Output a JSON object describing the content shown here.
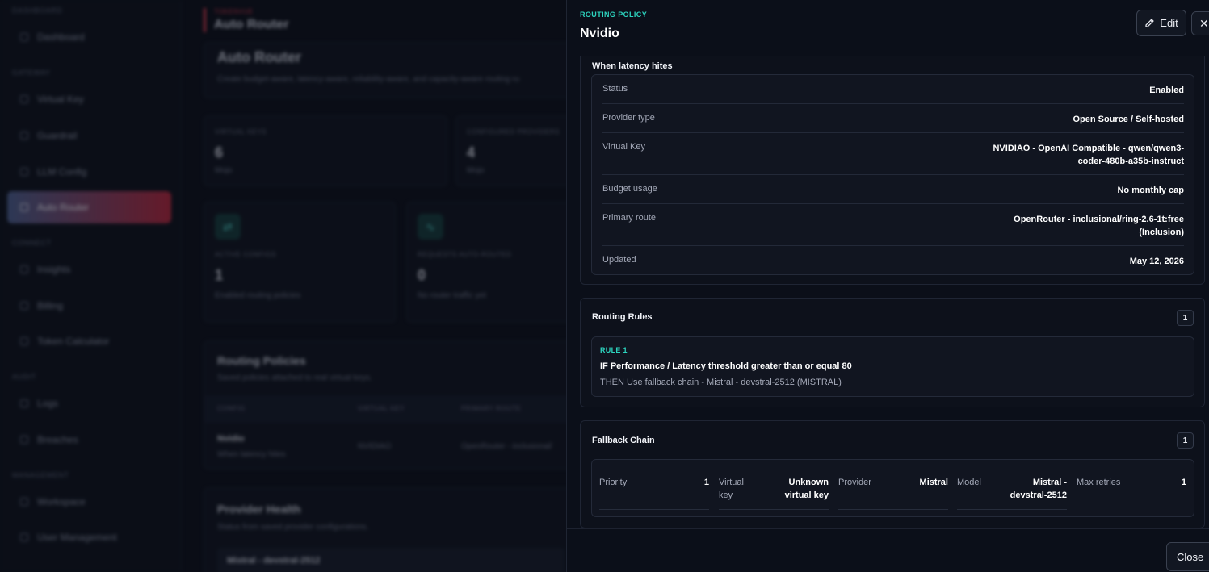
{
  "background": {
    "sidebar": {
      "sections": [
        {
          "label": "DASHBOARD"
        },
        {
          "label": "GATEWAY"
        },
        {
          "label": "CONNECT"
        },
        {
          "label": "AUDIT"
        },
        {
          "label": "MANAGEMENT"
        }
      ],
      "items": [
        {
          "label": "Dashboard"
        },
        {
          "label": "Virtual Key"
        },
        {
          "label": "Guardrail"
        },
        {
          "label": "LLM Config"
        },
        {
          "label": "Auto Router",
          "active": true
        },
        {
          "label": "Insights"
        },
        {
          "label": "Billing"
        },
        {
          "label": "Token Calculator"
        },
        {
          "label": "Logs"
        },
        {
          "label": "Breaches"
        },
        {
          "label": "Workspace"
        },
        {
          "label": "User Management"
        }
      ]
    },
    "header": {
      "eyebrow": "TOKENVUE",
      "title": "Auto Router"
    },
    "intro": {
      "title": "Auto Router",
      "subtitle": "Create budget-aware, latency-aware, reliability-aware, and capacity-aware routing ru"
    },
    "stats": [
      {
        "label": "VIRTUAL KEYS",
        "value": "6",
        "sub": "Mojo"
      },
      {
        "label": "CONFIGURED PROVIDERS",
        "value": "4",
        "sub": "Mojo"
      }
    ],
    "metrics": [
      {
        "label": "ACTIVE CONFIGS",
        "value": "1",
        "sub": "Enabled routing policies"
      },
      {
        "label": "REQUESTS AUTO-ROUTED",
        "value": "0",
        "sub": "No router traffic yet"
      }
    ],
    "policies": {
      "title": "Routing Policies",
      "subtitle": "Saved policies attached to real virtual keys.",
      "columns": [
        "CONFIG",
        "VIRTUAL KEY",
        "PRIMARY ROUTE"
      ],
      "row": {
        "name": "Nvidio",
        "desc": "When latency hites",
        "vkey": "NVIDIAO",
        "route": "OpenRouter - inclusional/"
      }
    },
    "health": {
      "title": "Provider Health",
      "subtitle": "Status from saved provider configurations.",
      "item": "Mistral - devstral-2512"
    }
  },
  "drawer": {
    "eyebrow": "ROUTING POLICY",
    "title": "Nvidio",
    "edit_label": "Edit",
    "close_x": "✕",
    "summary": {
      "heading": "When latency hites",
      "rows": [
        {
          "label": "Status",
          "value": "Enabled"
        },
        {
          "label": "Provider type",
          "value": "Open Source / Self-hosted"
        },
        {
          "label": "Virtual Key",
          "value": "NVIDIAO - OpenAI Compatible - qwen/qwen3-coder-480b-a35b-instruct"
        },
        {
          "label": "Budget usage",
          "value": "No monthly cap"
        },
        {
          "label": "Primary route",
          "value": "OpenRouter - inclusional/ring-2.6-1t:free (Inclusion)"
        },
        {
          "label": "Updated",
          "value": "May 12, 2026"
        }
      ]
    },
    "routing_rules": {
      "title": "Routing Rules",
      "count": "1",
      "rule": {
        "tag": "RULE 1",
        "condition": "IF Performance / Latency threshold greater than or equal 80",
        "action": "THEN Use fallback chain - Mistral - devstral-2512 (MISTRAL)"
      }
    },
    "fallback_chain": {
      "title": "Fallback Chain",
      "count": "1",
      "fields": [
        {
          "label": "Priority",
          "value": "1"
        },
        {
          "label": "Virtual key",
          "value": "Unknown virtual key"
        },
        {
          "label": "Provider",
          "value": "Mistral"
        },
        {
          "label": "Model",
          "value": "Mistral - devstral-2512"
        },
        {
          "label": "Max retries",
          "value": "1"
        }
      ]
    },
    "footer": {
      "close_label": "Close"
    }
  },
  "colors": {
    "accent": "#2dd4bf",
    "brand_red": "#d2394c",
    "background": "#0a0d16"
  }
}
